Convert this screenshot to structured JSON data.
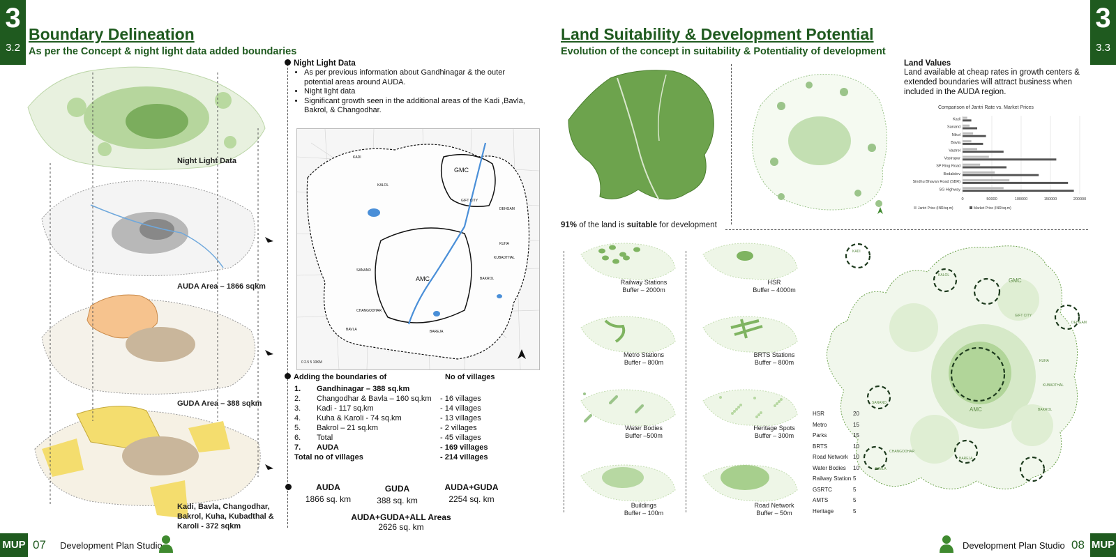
{
  "left": {
    "tab_num": "3",
    "tab_sub": "3.2",
    "title": "Boundary Delineation",
    "subtitle": "As per the Concept & night light data added boundaries",
    "layer_labels": [
      "Night Light Data",
      "AUDA Area – 1866 sqkm",
      "GUDA Area – 388 sqkm",
      "Kadi, Bavla, Changodhar, Bakrol, Kuha, Kubadthal & Karoli  - 372 sqkm"
    ],
    "night_light": {
      "heading": "Night Light Data",
      "bullets": [
        "As per previous information about Gandhinagar & the outer potential areas around AUDA.",
        "Night light data",
        "Significant growth seen in the additional areas of the Kadi ,Bavla, Bakrol, & Changodhar."
      ]
    },
    "map_labels": {
      "gmc": "GMC",
      "amc": "AMC",
      "kadi": "KADI",
      "kalol": "KALOL",
      "sanand": "SANAND",
      "bavla": "BAVLA",
      "dehgam": "DEHGAM",
      "bareja": "BAREJA",
      "changodhar": "CHANGODHAR",
      "bakrol": "BAKROL",
      "kuha": "KUHA",
      "kubadthal": "KUBADTHAL",
      "gift": "GIFT CITY",
      "scale": "0   2.5   5      10KM"
    },
    "villages": {
      "heading": "Adding the boundaries of",
      "col_heading": "No of villages",
      "rows": [
        {
          "n": "1.",
          "name": "Gandhinagar – 388 sq.km",
          "v": "",
          "bold": true
        },
        {
          "n": "2.",
          "name": "Changodhar & Bavla – 160 sq.km",
          "v": "- 16 villages",
          "bold": false
        },
        {
          "n": "3.",
          "name": "Kadi  - 117 sq.km",
          "v": "- 14 villages",
          "bold": false
        },
        {
          "n": "4.",
          "name": "Kuha & Karoli  - 74 sq.km",
          "v": "- 13 villages",
          "bold": false
        },
        {
          "n": "5.",
          "name": "Bakrol – 21 sq.km",
          "v": "- 2 villages",
          "bold": false
        },
        {
          "n": "6.",
          "name": "Total",
          "v": "-  45 villages",
          "bold": false
        },
        {
          "n": "7.",
          "name": "AUDA",
          "v": "- 169 villages",
          "bold": true
        }
      ],
      "total_label": "Total no of villages",
      "total_value": "- 214 villages"
    },
    "areas": [
      {
        "name": "AUDA",
        "value": "1866 sq. km"
      },
      {
        "name": "GUDA",
        "value": "388 sq. km"
      },
      {
        "name": "AUDA+GUDA",
        "value": "2254 sq. km"
      }
    ],
    "area_total": {
      "name": "AUDA+GUDA+ALL Areas",
      "value": "2626 sq. km"
    },
    "footer": {
      "badge": "MUP",
      "page": "07",
      "studio": "Development Plan Studio"
    }
  },
  "right": {
    "tab_num": "3",
    "tab_sub": "3.3",
    "title": "Land Suitability & Development Potential",
    "subtitle": "Evolution of the concept in suitability & Potentiality of development",
    "suitable": {
      "pct": "91%",
      "pre": " of the land is ",
      "bold": "suitable",
      "post": " for development"
    },
    "land_values": {
      "heading": "Land Values",
      "text": "Land available at cheap rates in growth centers & extended boundaries will attract business when included in the AUDA region."
    },
    "buffers": [
      {
        "name": "Railway Stations",
        "buffer": "Buffer – 2000m"
      },
      {
        "name": "HSR",
        "buffer": "Buffer – 4000m"
      },
      {
        "name": "Metro Stations",
        "buffer": "Buffer – 800m"
      },
      {
        "name": "BRTS Stations",
        "buffer": "Buffer – 800m"
      },
      {
        "name": "Water Bodies",
        "buffer": "Buffer –500m"
      },
      {
        "name": "Heritage Spots",
        "buffer": "Buffer – 300m"
      },
      {
        "name": "Buildings",
        "buffer": "Buffer – 100m"
      },
      {
        "name": "Road Network",
        "buffer": "Buffer – 50m"
      }
    ],
    "weights": [
      {
        "k": "HSR",
        "v": "20"
      },
      {
        "k": "Metro",
        "v": "15"
      },
      {
        "k": "Parks",
        "v": "15"
      },
      {
        "k": "BRTS",
        "v": "10"
      },
      {
        "k": "Road Network",
        "v": "10"
      },
      {
        "k": "Water Bodies",
        "v": "10"
      },
      {
        "k": "Railway Station",
        "v": "5"
      },
      {
        "k": "GSRTC",
        "v": "5"
      },
      {
        "k": "AMTS",
        "v": "5"
      },
      {
        "k": "Heritage",
        "v": "5"
      }
    ],
    "potential_labels": {
      "gmc": "GMC",
      "amc": "AMC",
      "gift": "GIFT CITY",
      "dehgam": "DEHGAM",
      "kadi": "KADI",
      "kalol": "KALOL",
      "kuha": "KUHA",
      "kubadthal": "KUBADTHAL",
      "bakrol": "BAKROL",
      "changodhar": "CHANGODHAR",
      "sanand": "SANAND",
      "bavla": "BAVLA",
      "bareja": "BAREJA"
    },
    "footer": {
      "badge": "MUP",
      "page": "08",
      "studio": "Development Plan Studio"
    }
  },
  "chart_data": {
    "type": "bar",
    "orientation": "horizontal",
    "title": "Comparison of Jantri Rate vs. Market Prices",
    "categories": [
      "Kadi",
      "Sanand",
      "Nikol",
      "Bavla",
      "Vastrel",
      "Vastrapur",
      "SP Ring Road",
      "Bodakdev",
      "Sindhu Bhavan Road (SBR)",
      "SG Highway"
    ],
    "series": [
      {
        "name": "Jantri Price (INR/sq.m)",
        "color": "#bdbdbd",
        "values": [
          8000,
          12000,
          18000,
          15000,
          25000,
          45000,
          30000,
          55000,
          80000,
          70000
        ]
      },
      {
        "name": "Market Price (INR/sq.m)",
        "color": "#555555",
        "values": [
          15000,
          25000,
          40000,
          35000,
          70000,
          160000,
          75000,
          130000,
          180000,
          190000
        ]
      }
    ],
    "xlim": [
      0,
      200000
    ],
    "x_ticks": [
      "0",
      "50000",
      "100000",
      "150000",
      "200000"
    ],
    "grid": true,
    "legend": "bottom"
  },
  "colors": {
    "accent": "#1f5a1f",
    "green_map": "#6da34d",
    "light_green": "#cfe5bf"
  },
  "icons": [
    "north-arrow-icon",
    "person-icon",
    "pointer-arrow-icon"
  ]
}
